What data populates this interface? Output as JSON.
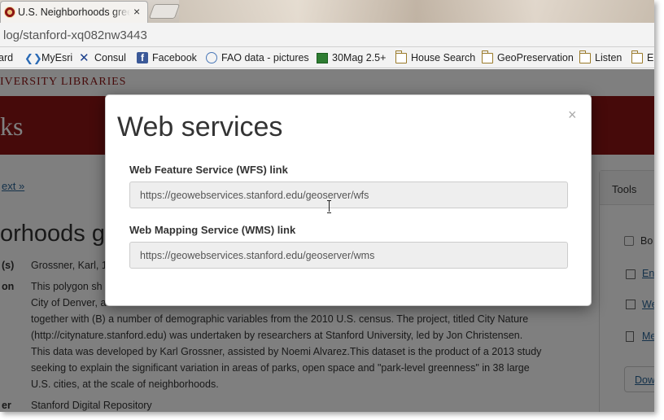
{
  "browser": {
    "tab_title": "U.S. Neighborhoods greenness",
    "tab_close": "×",
    "url": "log/stanford-xq082nw3443",
    "bookmarks": [
      {
        "label": "ard",
        "icon": "card-icon"
      },
      {
        "label": "MyEsri",
        "icon": "esri-icon"
      },
      {
        "label": "Consul",
        "icon": "consul-x-icon"
      },
      {
        "label": "Facebook",
        "icon": "facebook-icon"
      },
      {
        "label": "FAO data - pictures",
        "icon": "fao-globe-icon"
      },
      {
        "label": "30Mag 2.5+",
        "icon": "map-icon"
      },
      {
        "label": "House Search",
        "icon": "folder-icon"
      },
      {
        "label": "GeoPreservation",
        "icon": "folder-icon"
      },
      {
        "label": "Listen",
        "icon": "folder-icon"
      },
      {
        "label": "E",
        "icon": "folder-icon"
      }
    ]
  },
  "page": {
    "library_header": "IVERSITY LIBRARIES",
    "band_title": "ks",
    "next_link": "ext »",
    "heading": "orhoods g",
    "author_label": "(s)",
    "author_value": "Grossner, Karl, 1",
    "description_label": "on",
    "description_lines": [
      "This polygon sh",
      "City of Denver, a",
      "together with (B) a number of demographic variables from the 2010 U.S. census. The project, titled City Nature",
      "(http://citynature.stanford.edu) was undertaken by researchers at Stanford University, led by Jon Christensen.",
      "This data was developed by Karl Grossner, assisted by Noemi Alvarez.This dataset is the product of a 2013 study",
      "seeking to explain the significant variation in areas of parks, open space and \"park-level greenness\" in 38 large",
      "U.S. cities, at the scale of neighborhoods."
    ],
    "publisher_label": "er",
    "publisher_value": "Stanford Digital Repository",
    "tools": {
      "title": "Tools",
      "bookmark_label": "Bo",
      "email_label": "En",
      "web_services_label": "We",
      "metadata_label": "Me",
      "download_label": "Dow"
    }
  },
  "modal": {
    "title": "Web services",
    "close": "×",
    "wfs_label": "Web Feature Service (WFS) link",
    "wfs_value": "https://geowebservices.stanford.edu/geoserver/wfs",
    "wms_label": "Web Mapping Service (WMS) link",
    "wms_value": "https://geowebservices.stanford.edu/geoserver/wms"
  },
  "colors": {
    "stanford_red": "#8c1515",
    "link_blue": "#2a6496",
    "overlay": "rgba(0,0,0,0.5)",
    "input_bg": "#eeeeee"
  }
}
